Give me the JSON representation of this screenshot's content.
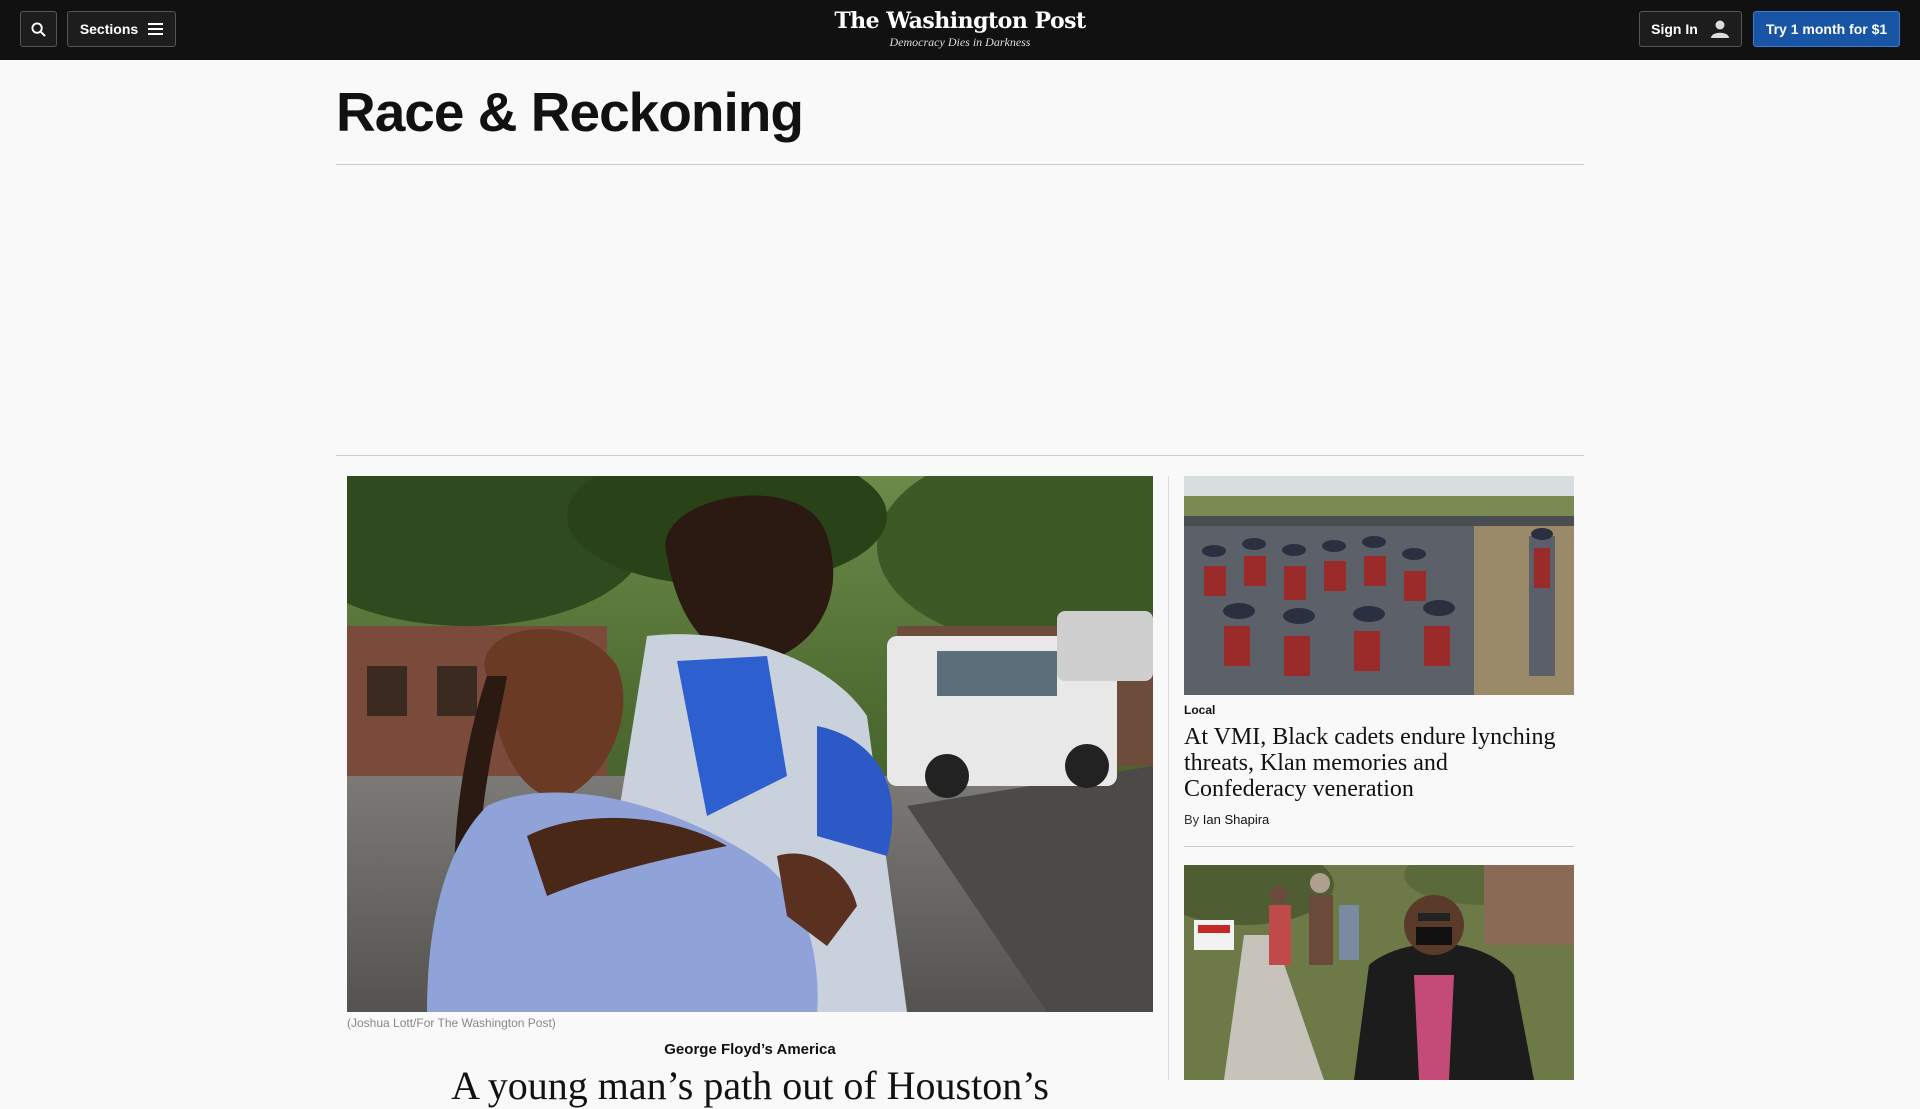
{
  "nav": {
    "sections_label": "Sections",
    "signin_label": "Sign In",
    "trial_label": "Try 1 month for $1"
  },
  "masthead": {
    "logo": "The Washington Post",
    "tagline": "Democracy Dies in Darkness"
  },
  "page": {
    "title": "Race & Reckoning"
  },
  "lead_story": {
    "caption": "(Joshua Lott/For The Washington Post)",
    "kicker": "George Floyd’s America",
    "headline_partial": "A young man’s path out of Houston’s"
  },
  "rail": {
    "story1": {
      "kicker": "Local",
      "headline": "At VMI, Black cadets endure lynching threats, Klan memories and Confederacy veneration",
      "by": "By",
      "author": "Ian Shapira"
    }
  },
  "colors": {
    "topbar": "#111111",
    "trial_button": "#1955a5",
    "page_bg": "#f9f9f9"
  }
}
